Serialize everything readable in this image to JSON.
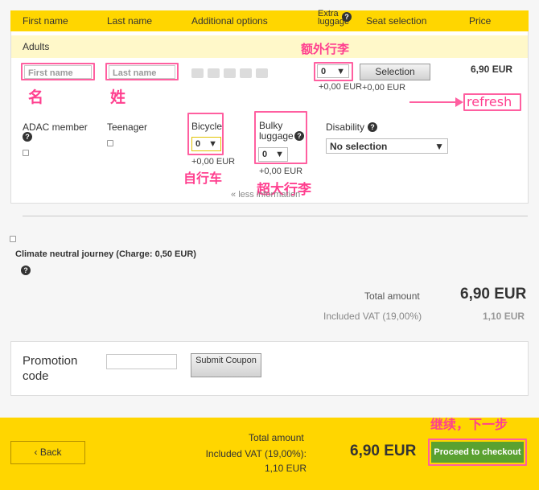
{
  "header": {
    "first_name": "First name",
    "last_name": "Last name",
    "additional_options": "Additional options",
    "extra_luggage": "Extra luggage",
    "seat_selection": "Seat selection",
    "price": "Price"
  },
  "adults_label": "Adults",
  "passenger": {
    "first_name_placeholder": "First name",
    "last_name_placeholder": "Last name",
    "option_icons": [
      "AMS",
      "U26",
      "bike",
      "mail",
      "TL"
    ],
    "extra_luggage_value": "0",
    "extra_luggage_price": "+0,00 EUR",
    "seat_button": "Selection",
    "seat_price": "+0,00 EUR",
    "price": "6,90 EUR"
  },
  "options": {
    "adac_label": "ADAC member",
    "teenager_label": "Teenager",
    "bicycle_label": "Bicycle",
    "bicycle_value": "0",
    "bicycle_price": "+0,00 EUR",
    "bulky_label": "Bulky luggage",
    "bulky_value": "0",
    "bulky_price": "+0,00 EUR",
    "disability_label": "Disability",
    "disability_value": "No selection",
    "less_info": "less information"
  },
  "annotations": {
    "first_name": "名",
    "last_name": "姓",
    "extra_luggage": "额外行李",
    "refresh": "refresh",
    "bicycle": "自行车",
    "bulky": "超大行李",
    "continue": "继续，下一步"
  },
  "climate": {
    "label": "Climate neutral journey (Charge: 0,50 EUR)"
  },
  "totals": {
    "total_label": "Total amount",
    "total_value": "6,90 EUR",
    "vat_label": "Included VAT (19,00%)",
    "vat_value": "1,10 EUR"
  },
  "promotion": {
    "label": "Promotion code",
    "submit": "Submit Coupon"
  },
  "footer": {
    "back": "Back",
    "total_label": "Total amount",
    "vat_line": "Included VAT (19,00%): 1,10 EUR",
    "total_value": "6,90 EUR",
    "proceed": "Proceed to checkout"
  },
  "colors": {
    "brand_yellow": "#ffd600",
    "annotation_pink": "#ff3f8f",
    "proceed_green": "#5aa130"
  }
}
